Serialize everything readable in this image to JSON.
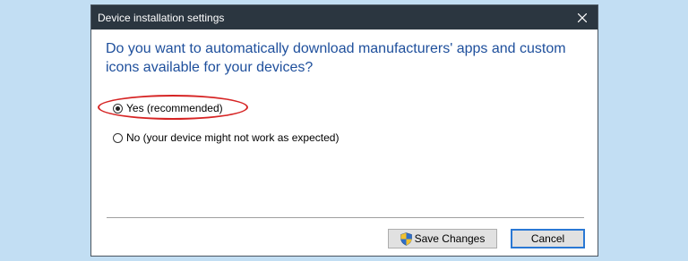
{
  "window": {
    "title": "Device installation settings"
  },
  "question": "Do you want to automatically download manufacturers' apps and custom icons available for your devices?",
  "options": [
    {
      "label": "Yes (recommended)",
      "selected": true
    },
    {
      "label": "No (your device might not work as expected)",
      "selected": false
    }
  ],
  "buttons": {
    "save_label": "Save Changes",
    "cancel_label": "Cancel"
  },
  "icons": {
    "close": "close-icon",
    "save": "uac-shield-icon"
  },
  "colors": {
    "titlebar": "#2b3640",
    "question_text": "#1e4f9c",
    "highlight": "#d62424",
    "focus_border": "#2a78d4",
    "background": "#c2def3"
  }
}
